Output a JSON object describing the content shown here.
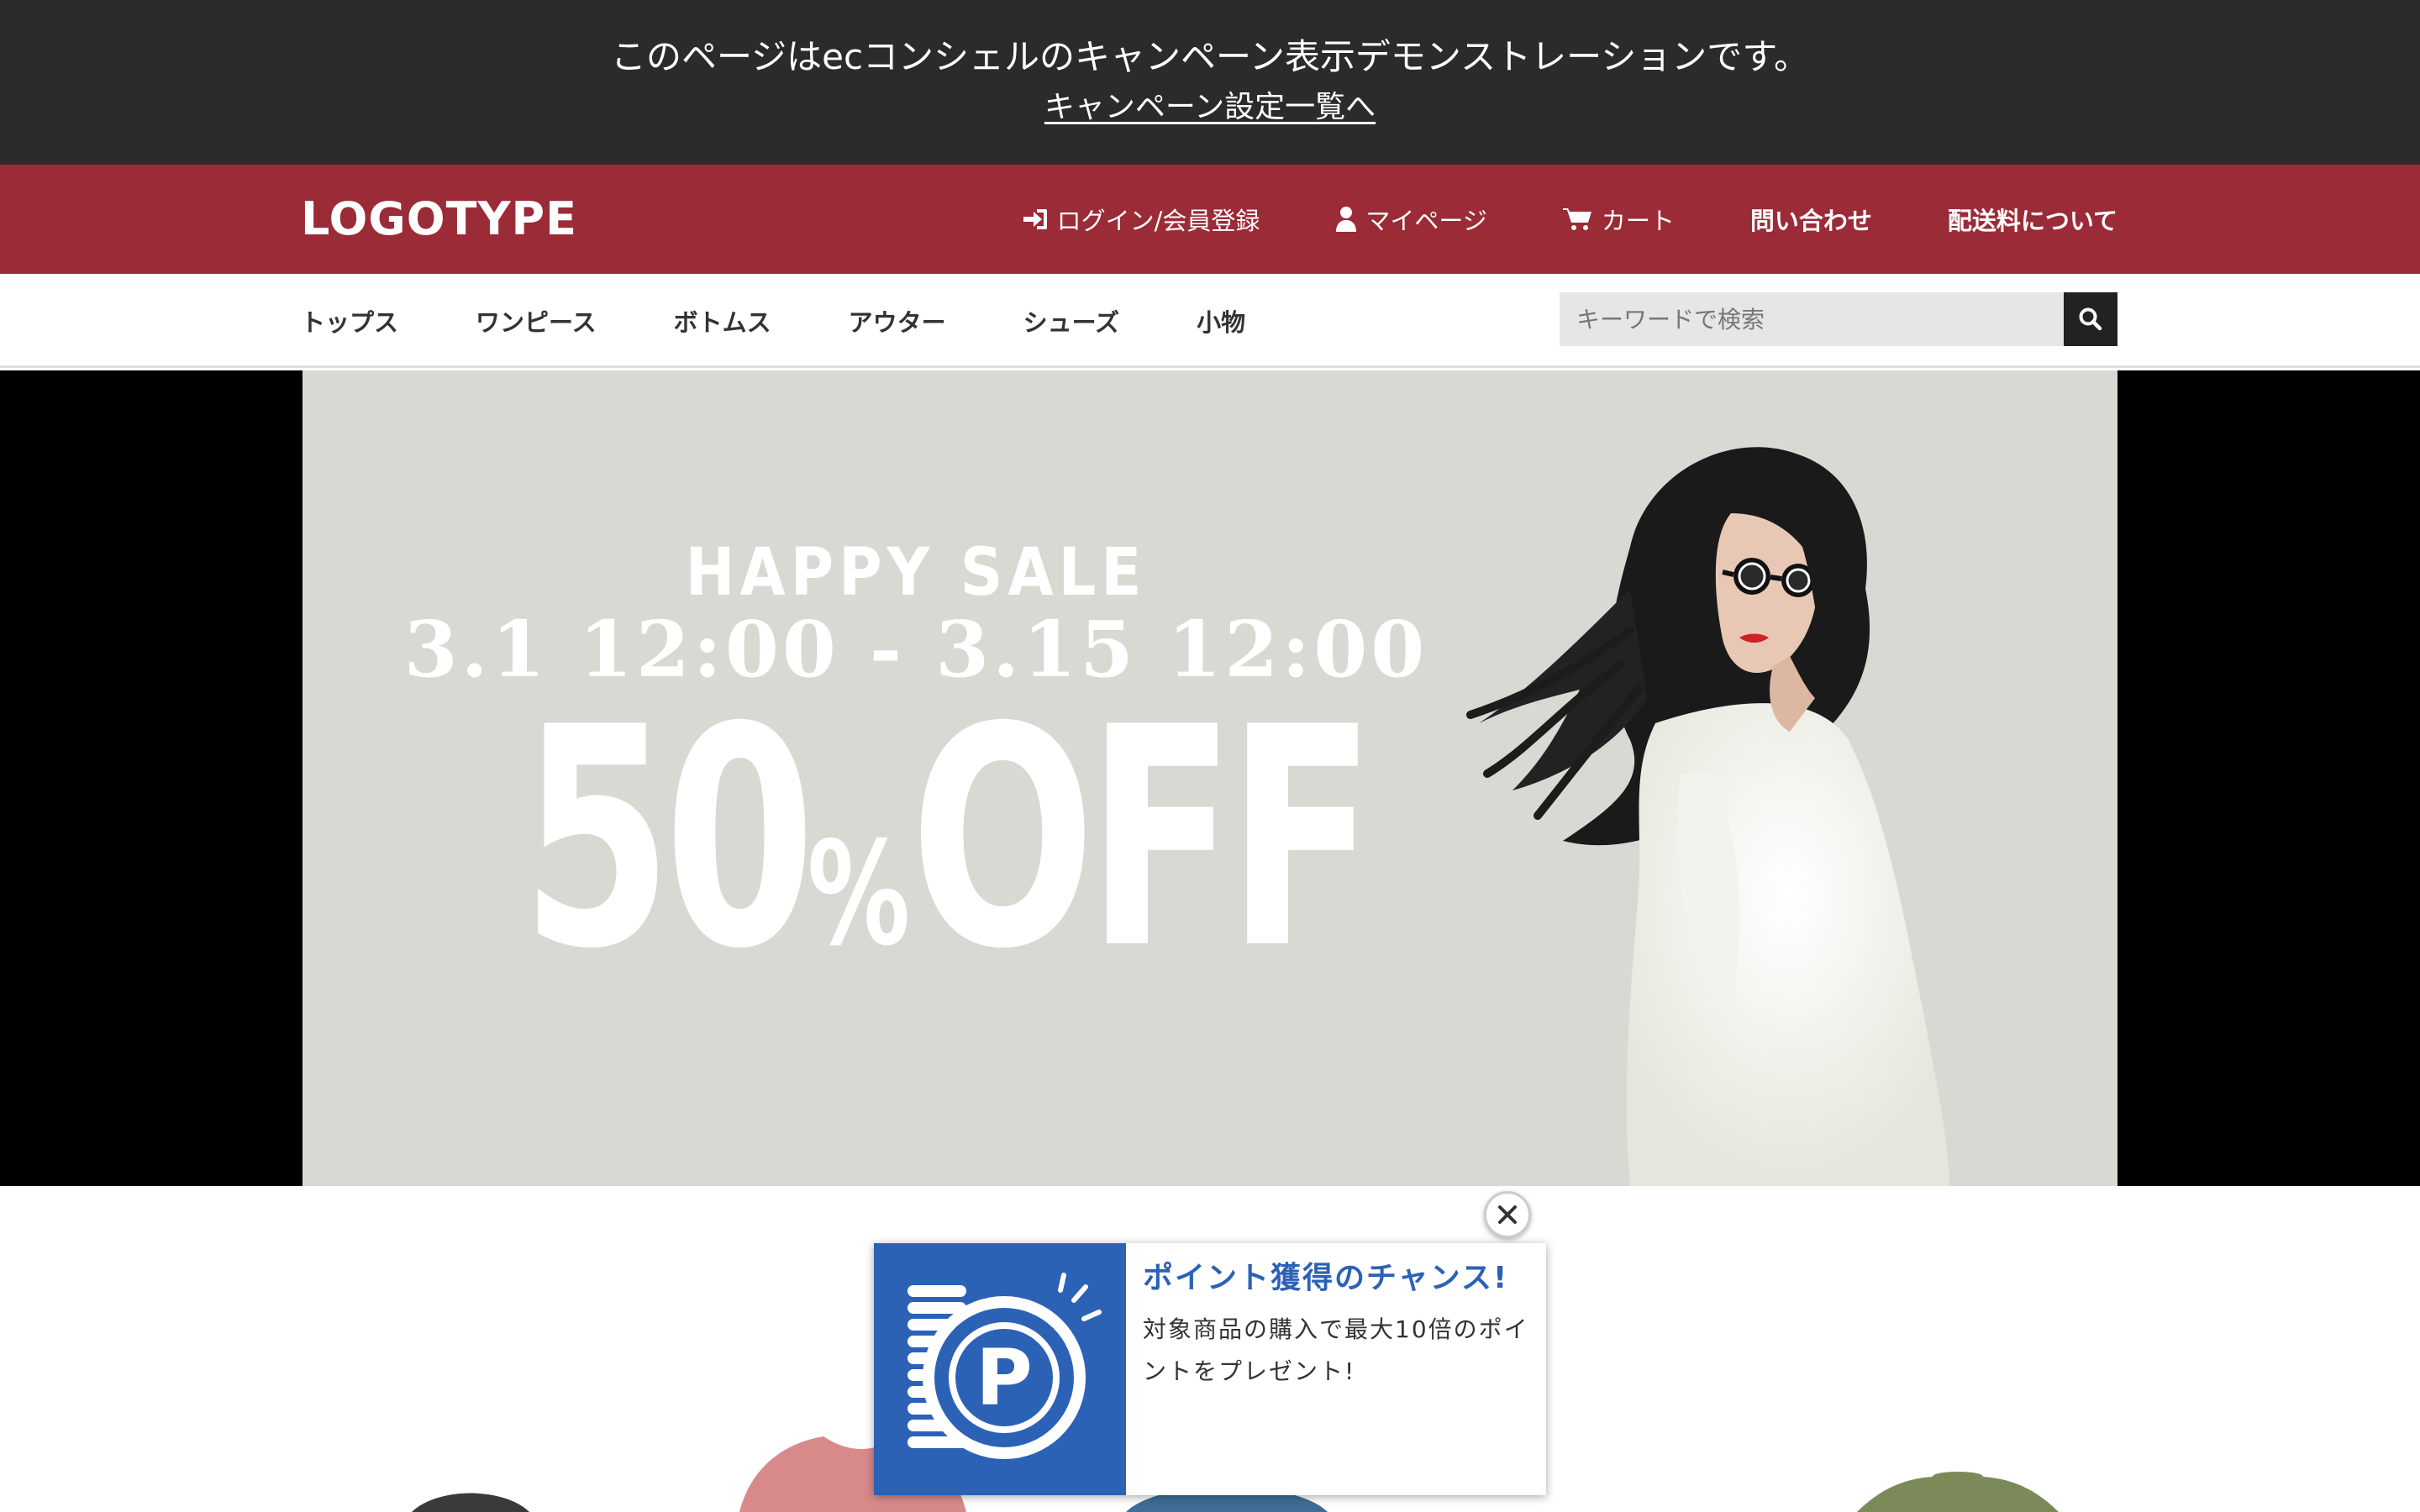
{
  "demo_banner": {
    "message": "このページはecコンシェルのキャンペーン表示デモンストレーションです。",
    "link": "キャンペーン設定一覧へ"
  },
  "header": {
    "logo": "LOGOTYPE",
    "nav": [
      {
        "label": "ログイン/会員登録",
        "icon": "sign-in-icon"
      },
      {
        "label": "マイページ",
        "icon": "user-icon"
      },
      {
        "label": "カート",
        "icon": "cart-icon"
      },
      {
        "label": "問い合わせ",
        "icon": ""
      },
      {
        "label": "配送料について",
        "icon": ""
      }
    ],
    "color": "#9b2b37"
  },
  "categories": [
    "トップス",
    "ワンピース",
    "ボトムス",
    "アウター",
    "シューズ",
    "小物"
  ],
  "search": {
    "placeholder": "キーワードで検索"
  },
  "hero": {
    "line1": "HAPPY SALE",
    "line2": "3.1 12:00 - 3.15 12:00",
    "discount_number": "50",
    "discount_pct": "%",
    "discount_off": "OFF"
  },
  "popup": {
    "title": "ポイント獲得のチャンス!",
    "body": "対象商品の購入で最大10倍のポイントをプレゼント!",
    "icon_letter": "P",
    "color": "#2c62b6"
  }
}
